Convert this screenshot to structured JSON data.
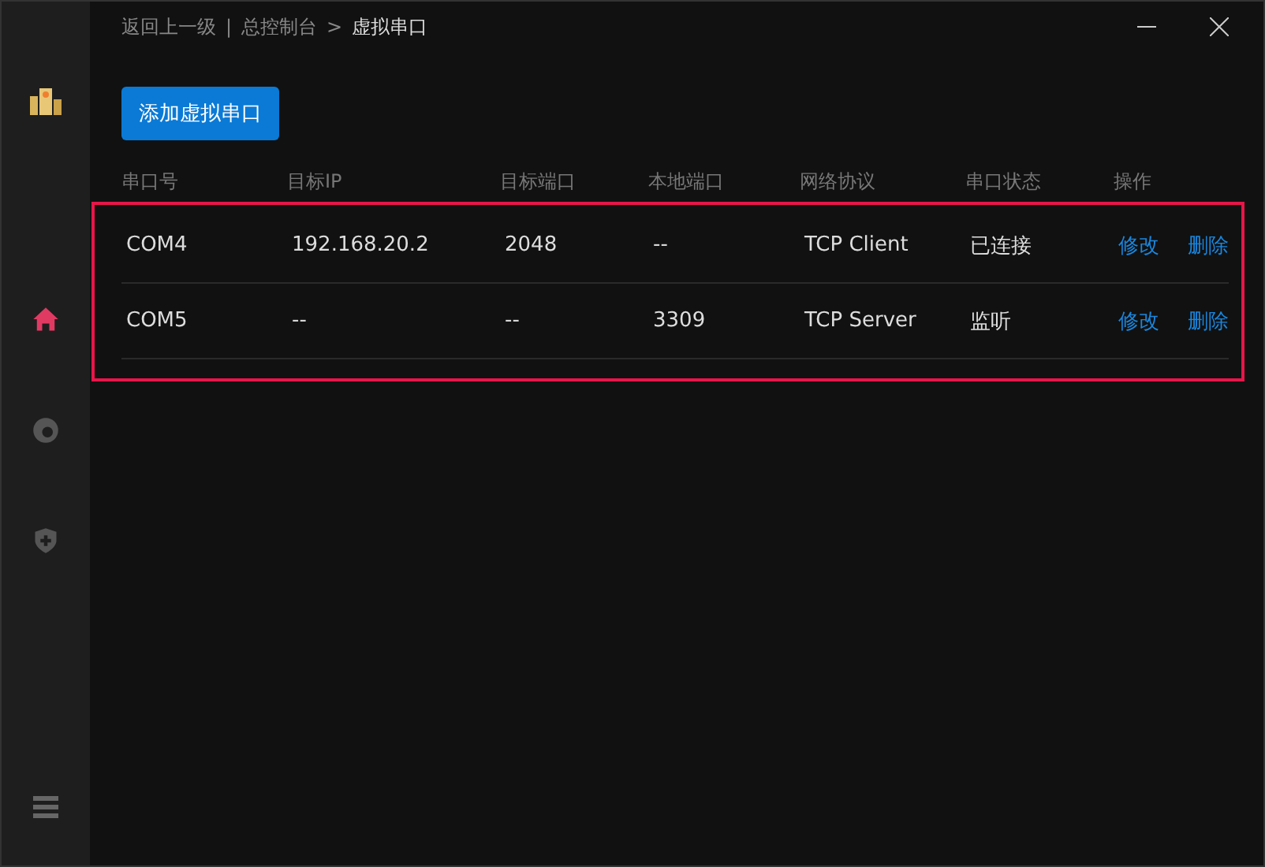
{
  "breadcrumb": {
    "back": "返回上一级",
    "separator": "|",
    "parent": "总控制台",
    "arrow": ">",
    "current": "虚拟串口"
  },
  "sidebar": {
    "items": [
      {
        "kind": "home",
        "selected": true
      },
      {
        "kind": "ring",
        "selected": false
      },
      {
        "kind": "shield",
        "selected": false
      }
    ]
  },
  "add_button": "添加虚拟串口",
  "table": {
    "columns": [
      "串口号",
      "目标IP",
      "目标端口",
      "本地端口",
      "网络协议",
      "串口状态",
      "操作"
    ],
    "rows": [
      {
        "cells": [
          "COM4",
          "192.168.20.2",
          "2048",
          "--",
          "TCP Client",
          "已连接"
        ],
        "actions": [
          "修改",
          "删除"
        ]
      },
      {
        "cells": [
          "COM5",
          "--",
          "--",
          "3309",
          "TCP Server",
          "监听"
        ],
        "actions": [
          "修改",
          "删除"
        ]
      }
    ]
  }
}
